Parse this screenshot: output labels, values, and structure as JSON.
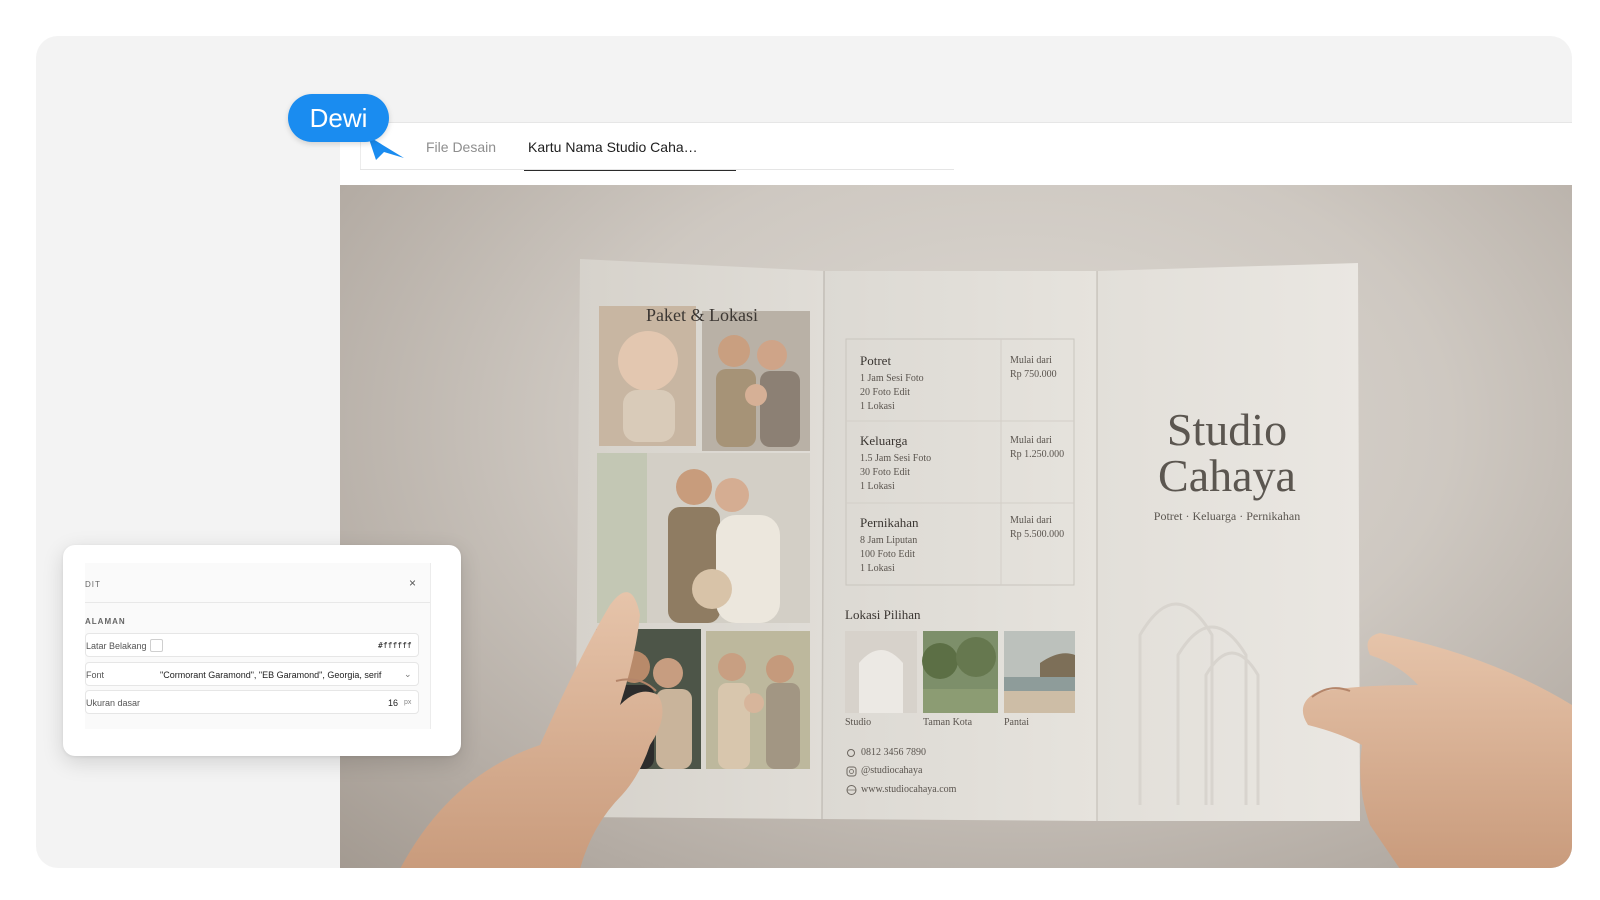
{
  "user": {
    "name": "Dewi"
  },
  "tabs": {
    "files": "File Desain",
    "active": "Kartu Nama Studio Caha…"
  },
  "brochure": {
    "section_title": "Paket & Lokasi",
    "packages": [
      {
        "name": "Potret",
        "lines": [
          "1 Jam Sesi Foto",
          "20 Foto Edit",
          "1 Lokasi"
        ],
        "from": "Mulai dari",
        "price": "Rp 750.000"
      },
      {
        "name": "Keluarga",
        "lines": [
          "1.5 Jam Sesi Foto",
          "30 Foto Edit",
          "1 Lokasi"
        ],
        "from": "Mulai dari",
        "price": "Rp 1.250.000"
      },
      {
        "name": "Pernikahan",
        "lines": [
          "8 Jam Liputan",
          "100 Foto Edit",
          "1 Lokasi"
        ],
        "from": "Mulai dari",
        "price": "Rp 5.500.000"
      }
    ],
    "locations_title": "Lokasi Pilihan",
    "locations": [
      "Studio",
      "Taman Kota",
      "Pantai"
    ],
    "contacts": {
      "phone": "0812 3456 7890",
      "instagram": "@studiocahaya",
      "website": "www.studiocahaya.com"
    },
    "brand_line1": "Studio",
    "brand_line2": "Cahaya",
    "tagline": "Potret · Keluarga · Pernikahan"
  },
  "panel": {
    "header_label": "DIT",
    "section_label": "ALAMAN",
    "background": {
      "label": "Latar Belakang",
      "value": "#ffffff"
    },
    "font": {
      "label": "Font",
      "value": "\"Cormorant Garamond\", \"EB Garamond\", Georgia, serif"
    },
    "base_size": {
      "label": "Ukuran dasar",
      "value": "16",
      "unit": "px"
    },
    "close_glyph": "×"
  },
  "colors": {
    "badge": "#1a8cf0",
    "paper": "#e6e3dd"
  }
}
